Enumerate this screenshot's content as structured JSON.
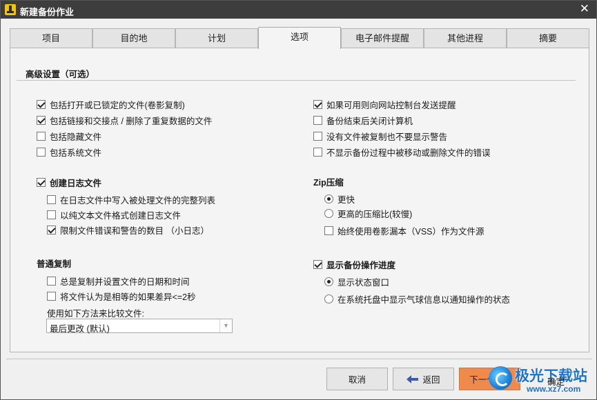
{
  "window": {
    "title": "新建备份作业",
    "close_glyph": "✕"
  },
  "tabs": [
    {
      "label": "项目"
    },
    {
      "label": "目的地"
    },
    {
      "label": "计划"
    },
    {
      "label": "选项",
      "active": true
    },
    {
      "label": "电子邮件提醒"
    },
    {
      "label": "其他进程"
    },
    {
      "label": "摘要"
    }
  ],
  "advanced": {
    "title": "高级设置（可选）"
  },
  "left_options": [
    {
      "label": "包括打开或已锁定的文件(卷影复制)",
      "checked": true
    },
    {
      "label": "包括链接和交接点 / 删除了重复数据的文件",
      "checked": true
    },
    {
      "label": "包括隐藏文件",
      "checked": false
    },
    {
      "label": "包括系统文件",
      "checked": false
    }
  ],
  "right_options": [
    {
      "label": "如果可用则向网站控制台发送提醒",
      "checked": true
    },
    {
      "label": "备份结束后关闭计算机",
      "checked": false
    },
    {
      "label": "没有文件被复制也不要显示警告",
      "checked": false
    },
    {
      "label": "不显示备份过程中被移动或删除文件的错误",
      "checked": false
    }
  ],
  "log": {
    "label": "创建日志文件",
    "checked": true,
    "options": [
      {
        "label": "在日志文件中写入被处理文件的完整列表",
        "checked": false
      },
      {
        "label": "以纯文本文件格式创建日志文件",
        "checked": false
      },
      {
        "label": "限制文件错误和警告的数目 （小日志）",
        "checked": true
      }
    ]
  },
  "zip": {
    "title": "Zip压缩",
    "radios": [
      {
        "label": "更快",
        "selected": true
      },
      {
        "label": "更高的压缩比(较慢)",
        "selected": false
      }
    ],
    "vss": {
      "label": "始终使用卷影漏本（VSS）作为文件源",
      "checked": false
    }
  },
  "copy": {
    "title": "普通复制",
    "options": [
      {
        "label": "总是复制并设置文件的日期和时间",
        "checked": false
      },
      {
        "label": "将文件认为是相等的如果差异<=2秒",
        "checked": false
      }
    ],
    "compare_label": "使用如下方法来比较文件:",
    "compare_value": "最后更改 (默认)"
  },
  "progress": {
    "label": "显示备份操作进度",
    "checked": true,
    "radios": [
      {
        "label": "显示状态窗口",
        "selected": true
      },
      {
        "label": "在系统托盘中显示气球信息以通知操作的状态",
        "selected": false
      }
    ]
  },
  "buttons": {
    "cancel": "取消",
    "back": "返回",
    "next": "下一个",
    "confirm": "确定"
  },
  "watermark": {
    "brand": "极光下载站",
    "url": "www.xz7.com"
  },
  "colors": {
    "titlebar": "#3d3d3d",
    "accent_next": "#f08a4b",
    "icon_yellow": "#f5c400"
  }
}
